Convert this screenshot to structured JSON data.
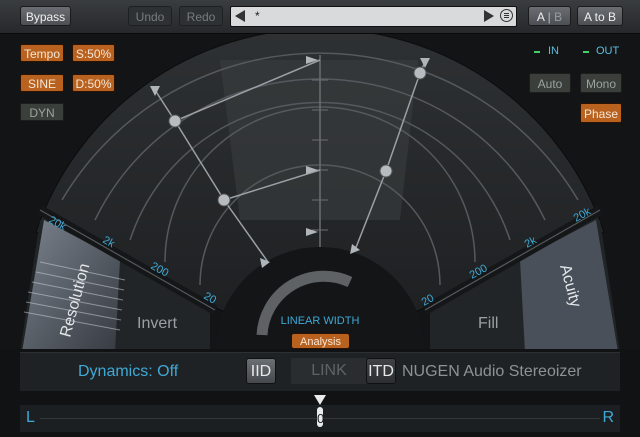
{
  "header": {
    "bypass": "Bypass",
    "undo": "Undo",
    "redo": "Redo",
    "preset_name": "*",
    "ab_a": "A",
    "ab_sep": "|",
    "ab_b": "B",
    "a_to_b": "A to B"
  },
  "left_controls": {
    "tempo": "Tempo",
    "s_percent": "S:50%",
    "sine": "SINE",
    "d_percent": "D:50%",
    "dyn": "DYN"
  },
  "right_controls": {
    "in": "IN",
    "out": "OUT",
    "auto": "Auto",
    "mono": "Mono",
    "phase": "Phase"
  },
  "display": {
    "left_scale": [
      "20k",
      "2k",
      "200",
      "20"
    ],
    "right_scale": [
      "20k",
      "2k",
      "200",
      "20"
    ],
    "resolution": "Resolution",
    "invert": "Invert",
    "fill": "Fill",
    "acuity": "Acuity",
    "linear_width": "LINEAR WIDTH",
    "analysis": "Analysis"
  },
  "bottom": {
    "dynamics": "Dynamics: Off",
    "iid": "IID",
    "link": "LINK",
    "itd": "ITD",
    "brand": "NUGEN Audio Stereoizer"
  },
  "balance": {
    "left": "L",
    "right": "R",
    "value": "0"
  },
  "colors": {
    "accent_blue": "#3fa9d6",
    "orange": "#b9621f",
    "meter_green": "#3fd16a"
  }
}
